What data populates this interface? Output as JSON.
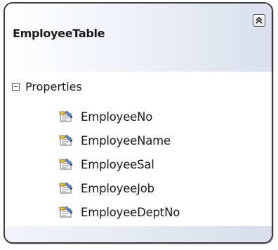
{
  "entity": {
    "title": "EmployeeTable",
    "collapse_icon": "double-chevron-up-icon"
  },
  "section": {
    "label": "Properties",
    "toggle_icon": "collapse-minus-icon",
    "expanded": true
  },
  "properties": [
    {
      "label": "EmployeeNo",
      "icon": "property-icon"
    },
    {
      "label": "EmployeeName",
      "icon": "property-icon"
    },
    {
      "label": "EmployeeSal",
      "icon": "property-icon"
    },
    {
      "label": "EmployeeJob",
      "icon": "property-icon"
    },
    {
      "label": "EmployeeDeptNo",
      "icon": "property-icon"
    }
  ],
  "colors": {
    "border": "#3c3c3c",
    "header_gradient_end": "#d9dfec"
  }
}
